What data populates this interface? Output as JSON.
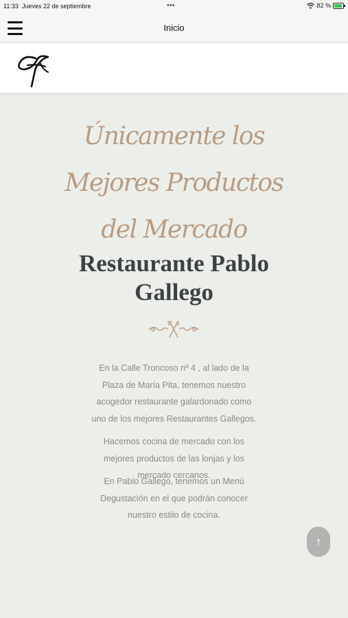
{
  "status_bar": {
    "time": "11:33",
    "date": "Jueves 22 de septiembre",
    "dots": "•••",
    "battery_pct": "82 %",
    "icons": [
      "wifi-icon",
      "battery-icon"
    ]
  },
  "navbar": {
    "title": "Inicio",
    "menu_icon": "hamburger-icon"
  },
  "logo": {
    "icon": "restaurant-logo-signature"
  },
  "hero": {
    "script_lines": [
      "Únicamente los",
      "Mejores Productos",
      "del Mercado"
    ],
    "title_lines": [
      "Restaurante Pablo",
      "Gallego"
    ],
    "ornament_icon": "fork-knife-ornament-icon"
  },
  "paragraphs": [
    "En la Calle Troncoso nº 4 , al lado de la Plaza de María Pita, tenemos nuestro acogedor restaurante galardonado como uno de los mejores Restaurantes Gallegos.",
    "Hacemos cocina de mercado con los mejores productos de las lonjas y los mercado cercanos.",
    "En Pablo Gallego, tenemos un Menú Degustación en el que podrán conocer nuestro estilo de cocina."
  ],
  "scroll_top": {
    "label": "↑",
    "icon": "arrow-up-icon"
  },
  "colors": {
    "background": "#eceeea",
    "script_accent": "#b99c82",
    "title": "#3e4245",
    "body_text": "#8a8a88",
    "battery": "#3cc14d"
  }
}
